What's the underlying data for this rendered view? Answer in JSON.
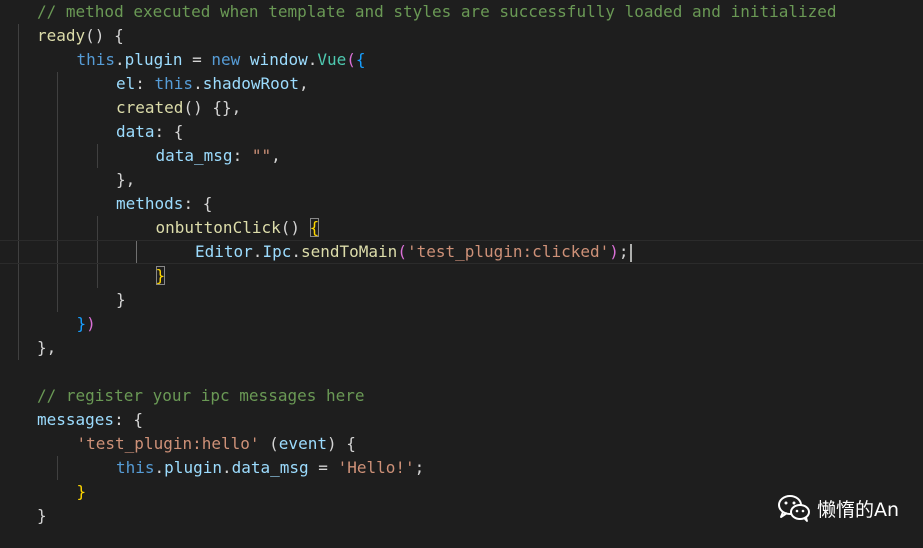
{
  "editor": {
    "theme": "dark",
    "background": "#1e1e1e",
    "lines": [
      {
        "tokens": [
          {
            "t": "// method executed when template and styles are successfully loaded and initialized",
            "c": "comment"
          }
        ]
      },
      {
        "tokens": [
          {
            "t": "ready",
            "c": "func"
          },
          {
            "t": "() {",
            "c": "punct"
          }
        ]
      },
      {
        "tokens": [
          {
            "t": "this",
            "c": "kw"
          },
          {
            "t": ".",
            "c": "punct"
          },
          {
            "t": "plugin",
            "c": "prop"
          },
          {
            "t": " = ",
            "c": "punct"
          },
          {
            "t": "new",
            "c": "kw"
          },
          {
            "t": " ",
            "c": "punct"
          },
          {
            "t": "window",
            "c": "prop"
          },
          {
            "t": ".",
            "c": "punct"
          },
          {
            "t": "Vue",
            "c": "cls"
          },
          {
            "t": "(",
            "c": "brk-pink"
          },
          {
            "t": "{",
            "c": "brk-blue"
          }
        ]
      },
      {
        "tokens": [
          {
            "t": "el",
            "c": "prop"
          },
          {
            "t": ": ",
            "c": "punct"
          },
          {
            "t": "this",
            "c": "kw"
          },
          {
            "t": ".",
            "c": "punct"
          },
          {
            "t": "shadowRoot",
            "c": "prop"
          },
          {
            "t": ",",
            "c": "punct"
          }
        ]
      },
      {
        "tokens": [
          {
            "t": "created",
            "c": "func"
          },
          {
            "t": "() {},",
            "c": "punct"
          }
        ]
      },
      {
        "tokens": [
          {
            "t": "data",
            "c": "prop"
          },
          {
            "t": ": {",
            "c": "punct"
          }
        ]
      },
      {
        "tokens": [
          {
            "t": "data_msg",
            "c": "prop"
          },
          {
            "t": ": ",
            "c": "punct"
          },
          {
            "t": "\"\"",
            "c": "str"
          },
          {
            "t": ",",
            "c": "punct"
          }
        ]
      },
      {
        "tokens": [
          {
            "t": "},",
            "c": "punct"
          }
        ]
      },
      {
        "tokens": [
          {
            "t": "methods",
            "c": "prop"
          },
          {
            "t": ": {",
            "c": "punct"
          }
        ]
      },
      {
        "tokens": [
          {
            "t": "onbuttonClick",
            "c": "func"
          },
          {
            "t": "() ",
            "c": "punct"
          },
          {
            "t": "{",
            "c": "brk-gold brk-match"
          }
        ]
      },
      {
        "tokens": [
          {
            "t": "Editor",
            "c": "prop"
          },
          {
            "t": ".",
            "c": "punct"
          },
          {
            "t": "Ipc",
            "c": "prop"
          },
          {
            "t": ".",
            "c": "punct"
          },
          {
            "t": "sendToMain",
            "c": "func"
          },
          {
            "t": "(",
            "c": "brk-pink"
          },
          {
            "t": "'test_plugin:clicked'",
            "c": "str"
          },
          {
            "t": ")",
            "c": "brk-pink"
          },
          {
            "t": ";",
            "c": "punct"
          }
        ],
        "cursor": true,
        "current": true
      },
      {
        "tokens": [
          {
            "t": "}",
            "c": "brk-gold brk-match"
          }
        ]
      },
      {
        "tokens": [
          {
            "t": "}",
            "c": "punct"
          }
        ]
      },
      {
        "tokens": [
          {
            "t": "}",
            "c": "brk-blue"
          },
          {
            "t": ")",
            "c": "brk-pink"
          }
        ]
      },
      {
        "tokens": [
          {
            "t": "},",
            "c": "punct"
          }
        ]
      },
      {
        "tokens": []
      },
      {
        "tokens": [
          {
            "t": "// register your ipc messages here",
            "c": "comment"
          }
        ]
      },
      {
        "tokens": [
          {
            "t": "messages",
            "c": "prop"
          },
          {
            "t": ": {",
            "c": "punct"
          }
        ]
      },
      {
        "tokens": [
          {
            "t": "'test_plugin:hello'",
            "c": "str"
          },
          {
            "t": " (",
            "c": "punct"
          },
          {
            "t": "event",
            "c": "param"
          },
          {
            "t": ") {",
            "c": "punct"
          }
        ]
      },
      {
        "tokens": [
          {
            "t": "this",
            "c": "kw"
          },
          {
            "t": ".",
            "c": "punct"
          },
          {
            "t": "plugin",
            "c": "prop"
          },
          {
            "t": ".",
            "c": "punct"
          },
          {
            "t": "data_msg",
            "c": "prop"
          },
          {
            "t": " = ",
            "c": "punct"
          },
          {
            "t": "'Hello!'",
            "c": "str"
          },
          {
            "t": ";",
            "c": "punct"
          }
        ]
      },
      {
        "tokens": [
          {
            "t": "}",
            "c": "brk-gold"
          }
        ]
      },
      {
        "tokens": [
          {
            "t": "}",
            "c": "punct"
          }
        ]
      }
    ]
  },
  "watermark": {
    "icon": "wechat-icon",
    "text": "懒惰的An"
  },
  "colors": {
    "comment": "#6a9955",
    "function": "#dcdcaa",
    "keyword": "#569cd6",
    "property": "#9cdcfe",
    "class": "#4ec9b0",
    "string": "#ce9178",
    "bracket_gold": "#ffd700",
    "bracket_pink": "#da70d6",
    "bracket_blue": "#179fff"
  }
}
